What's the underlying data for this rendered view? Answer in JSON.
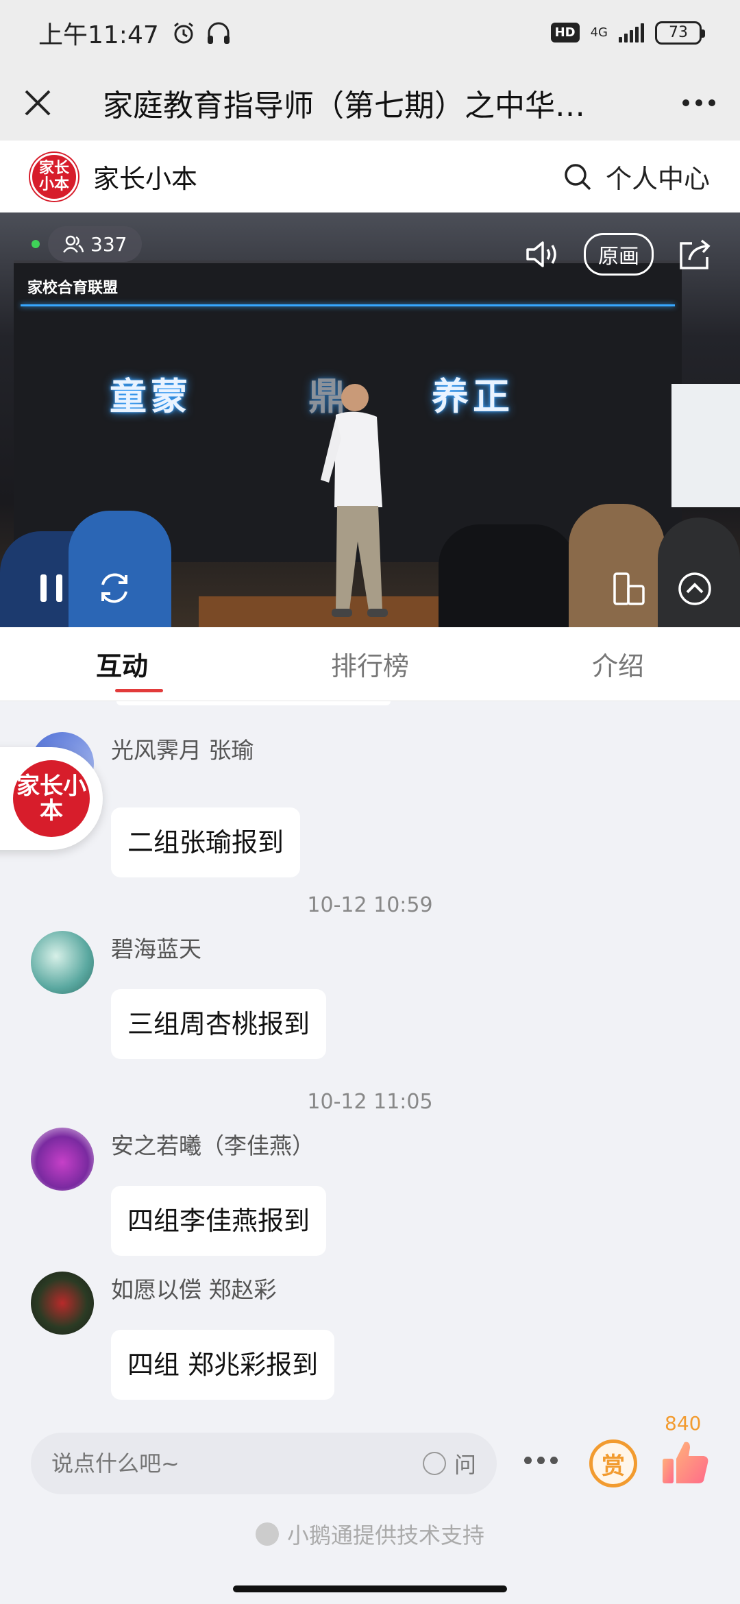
{
  "status": {
    "time": "上午11:47",
    "hd": "HD",
    "net": "4G",
    "battery": "73"
  },
  "titlebar": {
    "title": "家庭教育指导师（第七期）之中华…"
  },
  "brand": {
    "logo_text": "家长小本",
    "name": "家长小本",
    "user_center": "个人中心"
  },
  "video": {
    "viewers": "337",
    "quality_label": "原画",
    "screen_brand": "家校合育联盟",
    "screen_text_left": "童蒙",
    "screen_text_mid": "鼎",
    "screen_text_right": "养正"
  },
  "tabs": [
    {
      "label": "互动"
    },
    {
      "label": "排行榜"
    },
    {
      "label": "介绍"
    }
  ],
  "chat": {
    "messages": [
      {
        "nick": "光风霁月 张瑜",
        "text": "二组张瑜报到"
      },
      {
        "timestamp": "10-12 10:59",
        "nick": "碧海蓝天",
        "text": "三组周杏桃报到"
      },
      {
        "timestamp": "10-12 11:05",
        "nick": "安之若曦（李佳燕）",
        "text": "四组李佳燕报到"
      },
      {
        "nick": "如愿以偿 郑赵彩",
        "text": "四组 郑兆彩报到"
      }
    ]
  },
  "bottom": {
    "placeholder": "说点什么吧~",
    "ask_label": "问",
    "reward_label": "赏",
    "like_count": "840",
    "support_text": "小鹅通提供技术支持"
  },
  "colors": {
    "accent_red": "#d71d2b",
    "tab_underline": "#e23b3b",
    "reward_orange": "#f29b2f"
  }
}
